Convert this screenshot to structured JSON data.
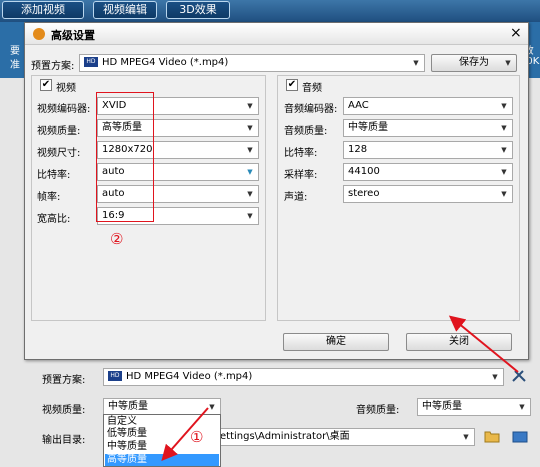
{
  "topbar": {
    "buttons": [
      "添加视频",
      "视频编辑",
      "3D效果"
    ]
  },
  "background": {
    "strip_left_top": "要",
    "strip_left_bottom": "准",
    "strip_right_top": "ε 教",
    "strip_right_bottom": "20K",
    "preset_label": "预置方案:",
    "preset_value": "HD MPEG4 Video (*.mp4)",
    "quality_label": "视频质量:",
    "quality_value": "中等质量",
    "audio_quality_label": "音频质量:",
    "audio_quality_value": "中等质量",
    "output_label": "输出目录:",
    "output_value": "ettings\\Administrator\\桌面"
  },
  "dialog": {
    "title": "高级设置",
    "close": "×",
    "preset_label": "预置方案:",
    "preset_value": "HD MPEG4 Video (*.mp4)",
    "save_as": "保存为",
    "ok": "确定",
    "close_button": "关闭",
    "video": {
      "title": "视频",
      "checked": "✔",
      "fields": [
        {
          "label": "视频编码器:",
          "value": "XVID"
        },
        {
          "label": "视频质量:",
          "value": "高等质量"
        },
        {
          "label": "视频尺寸:",
          "value": "1280x720"
        },
        {
          "label": "比特率:",
          "value": "auto"
        },
        {
          "label": "帧率:",
          "value": "auto"
        },
        {
          "label": "宽高比:",
          "value": "16:9"
        }
      ]
    },
    "audio": {
      "title": "音频",
      "checked": "✔",
      "fields": [
        {
          "label": "音频编码器:",
          "value": "AAC"
        },
        {
          "label": "音频质量:",
          "value": "中等质量"
        },
        {
          "label": "比特率:",
          "value": "128"
        },
        {
          "label": "采样率:",
          "value": "44100"
        },
        {
          "label": "声道:",
          "value": "stereo"
        }
      ]
    }
  },
  "dropdown": {
    "options": [
      "自定义",
      "低等质量",
      "中等质量",
      "高等质量"
    ],
    "selected_index": 3
  },
  "annotations": {
    "mark1": "①",
    "mark2": "②",
    "color": "#e0141e"
  },
  "icons": {
    "hd": "HD",
    "dropdown": "▼"
  }
}
